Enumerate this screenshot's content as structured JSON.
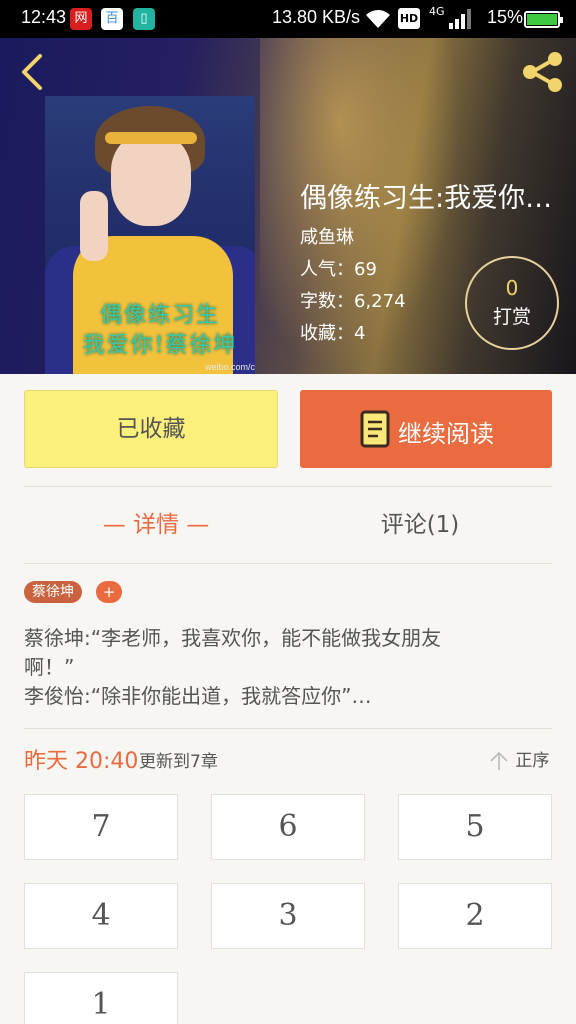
{
  "status_bar": {
    "time": "12:43",
    "apps": [
      "网",
      "百",
      "▯"
    ],
    "speed": "13.80 KB/s",
    "hd": "HD",
    "network": "4G",
    "battery_pct": "15%",
    "battery_level": 0.15
  },
  "header": {
    "back_icon": "chevron-left-icon",
    "share_icon": "share-icon",
    "cover_text": [
      "偶像练习生",
      "我爱你!蔡徐坤"
    ],
    "cover_watermark": "weibo.com/caiz",
    "title": "偶像练习生:我爱你…",
    "author": "咸鱼琳",
    "popularity": "人气：69",
    "word_count": "字数：6,274",
    "favorites": "收藏：4",
    "reward": {
      "count": "0",
      "label": "打赏"
    }
  },
  "actions": {
    "fav_label": "已收藏",
    "read_label": "继续阅读"
  },
  "tabs": {
    "detail": "— 详情 —",
    "comments": "评论(1)"
  },
  "tags": {
    "main": "蔡徐坤",
    "add": "+"
  },
  "intro": [
    "蔡徐坤:“李老师，我喜欢你，能不能做我女朋友",
    "啊！”",
    "李俊怡:“除非你能出道，我就答应你”…"
  ],
  "update": {
    "time": "昨天 20:40",
    "chapter": "更新到7章",
    "sort_label": "正序"
  },
  "chapters": [
    "7",
    "6",
    "5",
    "4",
    "3",
    "2",
    "1"
  ],
  "colors": {
    "accent": "#ea6b3f",
    "favorite_button": "#fbf07c",
    "reward_number": "#f3d36b"
  }
}
